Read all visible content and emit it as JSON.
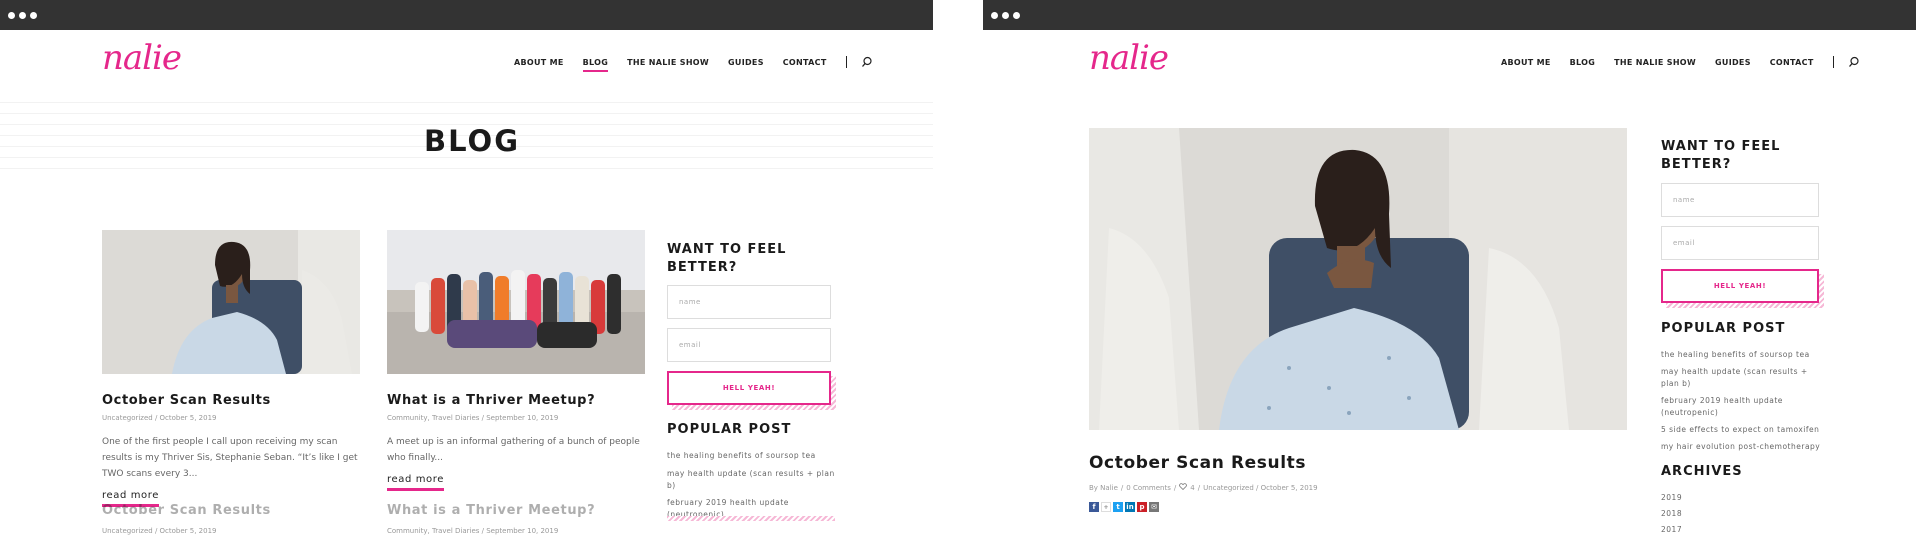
{
  "left": {
    "logo": "nalie",
    "nav": [
      "ABOUT ME",
      "BLOG",
      "THE NALIE SHOW",
      "GUIDES",
      "CONTACT"
    ],
    "page_title": "BLOG",
    "posts": [
      {
        "title": "October Scan Results",
        "meta": "Uncategorized / October 5, 2019",
        "excerpt": "One of the first people I call upon receiving my scan results is my Thriver Sis, Stephanie Seban. “It’s like I get TWO scans every 3...",
        "readmore": "read more"
      },
      {
        "title": "What is a Thriver Meetup?",
        "meta": "Community, Travel Diaries / September 10, 2019",
        "excerpt": "A meet up is an informal gathering of a bunch of people who finally...",
        "readmore": "read more"
      }
    ],
    "ghost_rows": [
      {
        "title": "October Scan Results",
        "meta": "Uncategorized / October 5, 2019"
      },
      {
        "title": "What is a Thriver Meetup?",
        "meta": "Community, Travel Diaries / September 10, 2019"
      }
    ],
    "sidebar": {
      "heading_line1": "WANT TO FEEL",
      "heading_line2": "BETTER?",
      "name_placeholder": "name",
      "email_placeholder": "email",
      "button": "HELL YEAH!",
      "popular_heading": "POPULAR POST",
      "popular": [
        "the healing benefits of soursop tea",
        "may health update (scan results + plan b)",
        "february 2019 health update (neutropenic)"
      ]
    }
  },
  "right": {
    "logo": "nalie",
    "nav": [
      "ABOUT ME",
      "BLOG",
      "THE NALIE SHOW",
      "GUIDES",
      "CONTACT"
    ],
    "post": {
      "title": "October Scan Results",
      "meta_by": "By Nalie",
      "meta_comments": "0 Comments",
      "meta_likes": "4",
      "meta_rest": "Uncategorized / October 5, 2019"
    },
    "sidebar": {
      "heading_line1": "WANT TO FEEL",
      "heading_line2": "BETTER?",
      "name_placeholder": "name",
      "email_placeholder": "email",
      "button": "HELL YEAH!",
      "popular_heading": "POPULAR POST",
      "popular": [
        "the healing benefits of soursop tea",
        "may health update (scan results + plan b)",
        "february 2019 health update (neutropenic)",
        "5 side effects to expect on tamoxifen",
        "my hair evolution post-chemotherapy"
      ],
      "archives_heading": "ARCHIVES",
      "archives": [
        "2019",
        "2018",
        "2017"
      ]
    }
  },
  "colors": {
    "accent": "#e5278b",
    "chrome": "#333333",
    "text": "#1a1a1a",
    "muted": "#999999"
  },
  "icons": [
    "search-icon",
    "facebook-icon",
    "google-plus-icon",
    "twitter-icon",
    "linkedin-icon",
    "pinterest-icon",
    "email-icon",
    "heart-icon"
  ]
}
